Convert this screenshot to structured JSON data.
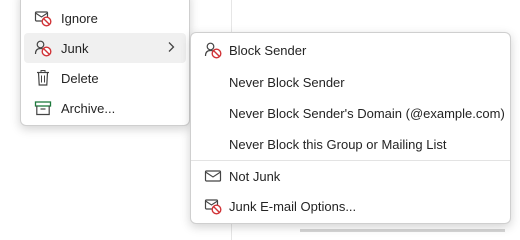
{
  "main_menu": {
    "items": [
      {
        "label": "Ignore",
        "icon": "ignore-icon"
      },
      {
        "label": "Junk",
        "icon": "junk-icon"
      },
      {
        "label": "Delete",
        "icon": "trash-icon"
      },
      {
        "label": "Archive...",
        "icon": "archive-icon"
      }
    ]
  },
  "junk_submenu": {
    "items": [
      {
        "label": "Block Sender",
        "icon": "block-sender-icon"
      },
      {
        "label": "Never Block Sender"
      },
      {
        "label": "Never Block Sender's Domain (@example.com)"
      },
      {
        "label": "Never Block this Group or Mailing List"
      },
      {
        "label": "Not Junk",
        "icon": "envelope-icon"
      },
      {
        "label": "Junk E-mail Options...",
        "icon": "junk-options-icon"
      }
    ]
  },
  "colors": {
    "accent_red": "#d13438",
    "archive_green": "#1d7a3c",
    "hover": "#f0f0f0"
  }
}
